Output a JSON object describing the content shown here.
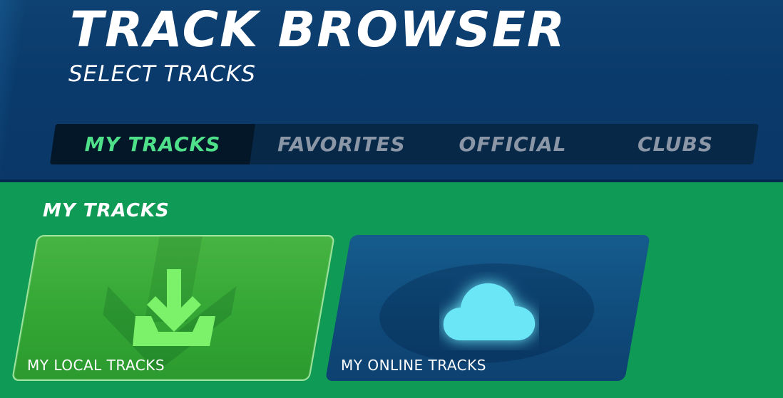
{
  "header": {
    "title": "TRACK BROWSER",
    "subtitle": "SELECT TRACKS"
  },
  "tabs": [
    {
      "label": "MY TRACKS",
      "active": true
    },
    {
      "label": "FAVORITES",
      "active": false
    },
    {
      "label": "OFFICIAL",
      "active": false
    },
    {
      "label": "CLUBS",
      "active": false
    }
  ],
  "section": {
    "title": "MY TRACKS"
  },
  "cards": [
    {
      "label": "MY LOCAL TRACKS",
      "icon": "download-icon"
    },
    {
      "label": "MY ONLINE TRACKS",
      "icon": "cloud-icon"
    }
  ],
  "colors": {
    "header_bg": "#0a3a6c",
    "content_bg": "#0f9b56",
    "active_tab_text": "#4fe08a",
    "inactive_tab_text": "#8b97a6",
    "local_card": "#3aab3a",
    "online_card": "#0f4a7a",
    "download_icon": "#7cf26a",
    "cloud_icon": "#6be6f7"
  }
}
